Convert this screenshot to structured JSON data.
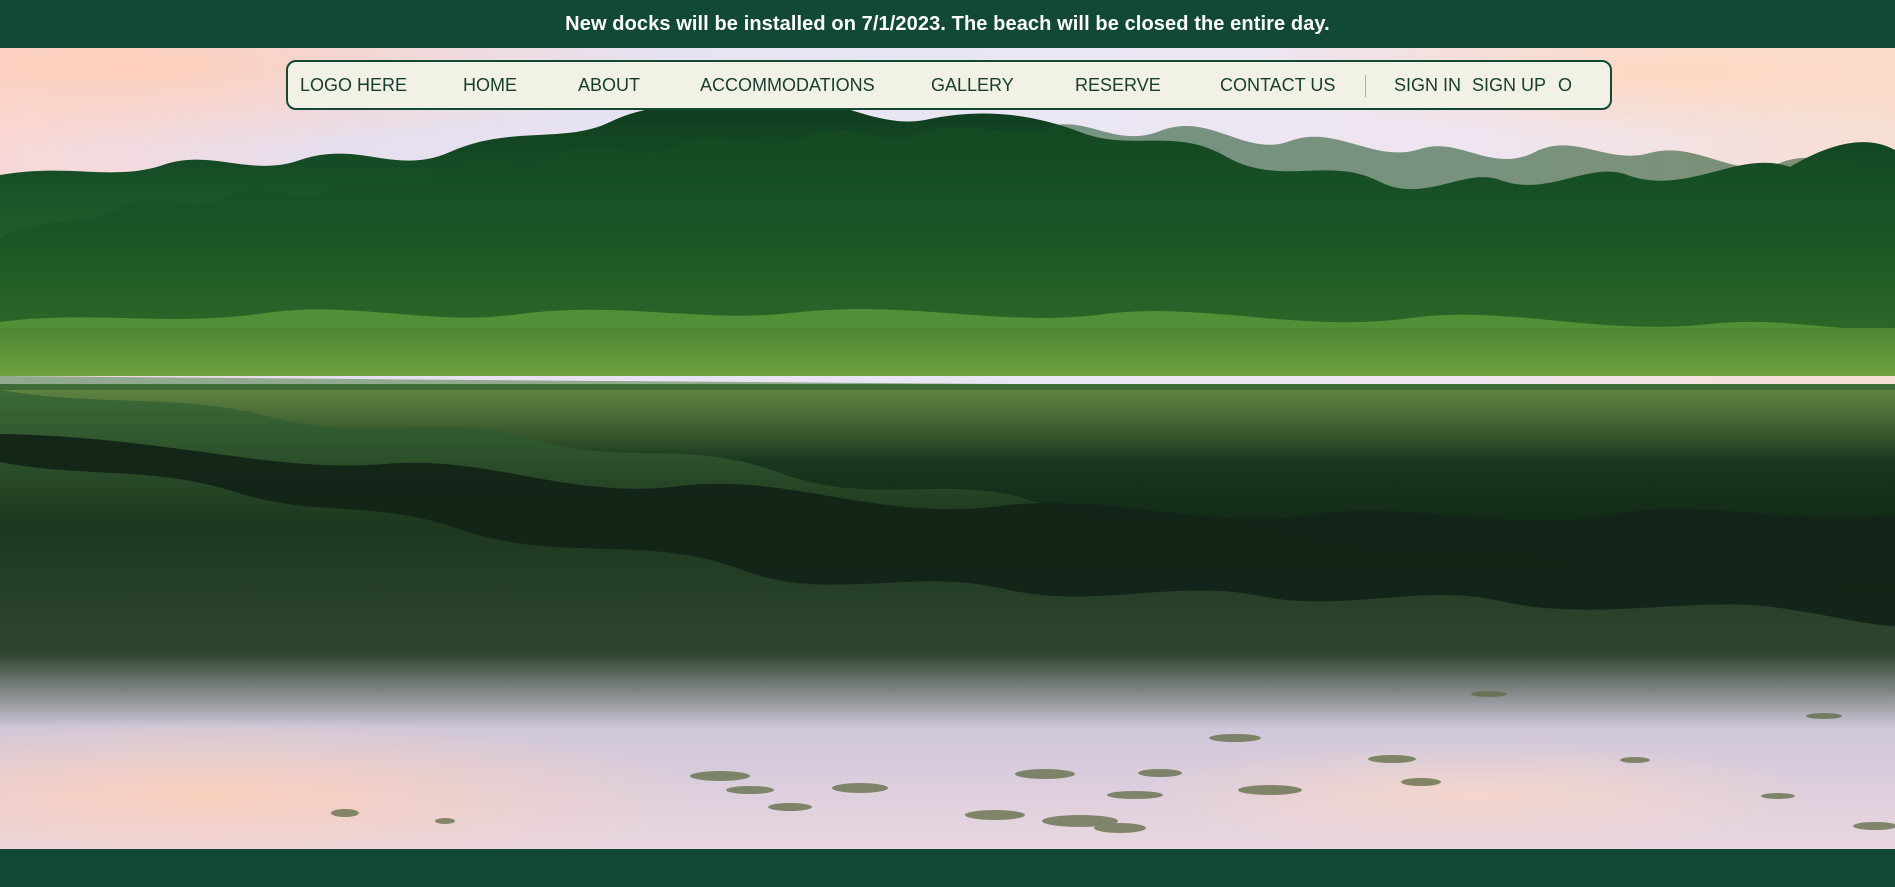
{
  "announcement": {
    "text": "New docks will be installed on 7/1/2023. The beach will be closed the entire day."
  },
  "navigation": {
    "logo": "LOGO HERE",
    "items": [
      "HOME",
      "ABOUT",
      "ACCOMMODATIONS",
      "GALLERY",
      "RESERVE",
      "CONTACT US"
    ],
    "sign_in": "SIGN IN",
    "sign_up": "SIGN UP",
    "extra": "O"
  },
  "colors": {
    "primary": "#124934",
    "nav_background": "#f2f1e6",
    "nav_text": "#163d2d"
  }
}
